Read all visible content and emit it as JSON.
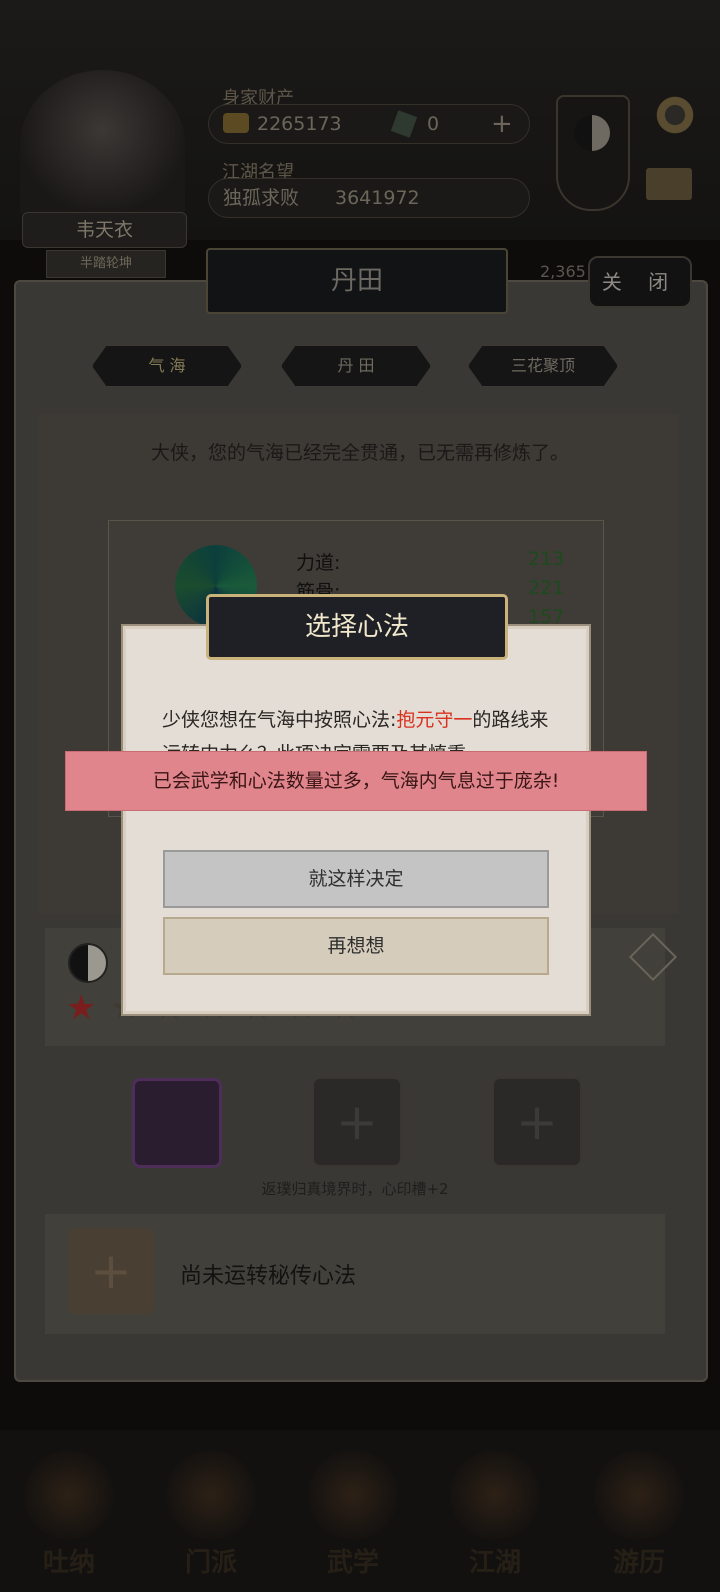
{
  "header": {
    "player_name": "韦天衣",
    "player_rank": "半踏轮坤",
    "wealth_label": "身家财产",
    "coins": "2265173",
    "jade": "0",
    "add_glyph": "+",
    "reputation_label": "江湖名望",
    "title": "独孤求败",
    "reputation_value": "3641972",
    "side_value": "2,365"
  },
  "panel": {
    "title": "丹田",
    "close_label": "关 闭",
    "tabs": [
      {
        "label": "气 海",
        "active": true
      },
      {
        "label": "丹 田",
        "active": false
      },
      {
        "label": "三花聚顶",
        "active": false
      }
    ],
    "message": "大侠，您的气海已经完全贯通，已无需再修炼了。",
    "stats": [
      {
        "label": "力道:",
        "value": "213"
      },
      {
        "label": "筋骨:",
        "value": "221"
      },
      {
        "label": "",
        "value": "157"
      }
    ],
    "stars_filled": 1,
    "stars_total": 7,
    "slot_hint": "返璞归真境界时，心印槽+2",
    "secret_text": "尚未运转秘传心法"
  },
  "dialog": {
    "title": "选择心法",
    "text_prefix": "少侠您想在气海中按照心法:",
    "highlight": "抱元守一",
    "text_suffix": "的路线来运转内力么？此项决定需要及其慎重",
    "confirm_label": "就这样决定",
    "cancel_label": "再想想"
  },
  "toast": "已会武学和心法数量过多，气海内气息过于庞杂!",
  "nav": [
    "吐纳",
    "门派",
    "武学",
    "江湖",
    "游历"
  ],
  "colors": {
    "highlight": "#d9311e",
    "toast_bg": "#e0858c",
    "dialog_bg": "#e3ddd5"
  }
}
